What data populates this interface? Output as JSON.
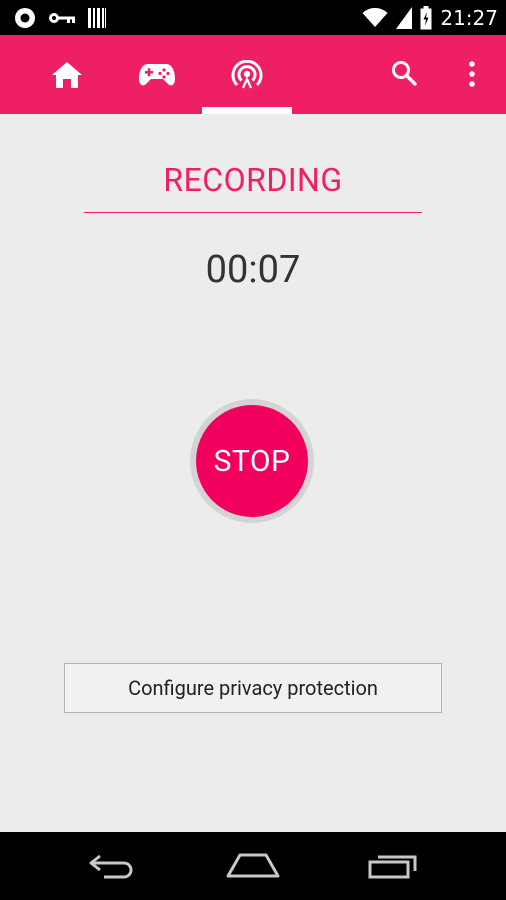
{
  "status_bar": {
    "time": "21:27",
    "icons": [
      "record-indicator-icon",
      "key-icon",
      "barcode-icon",
      "wifi-icon",
      "signal-icon",
      "battery-icon"
    ]
  },
  "app_bar": {
    "tabs": [
      {
        "name": "home",
        "icon": "home-icon"
      },
      {
        "name": "games",
        "icon": "gamepad-icon"
      },
      {
        "name": "live",
        "icon": "broadcast-icon",
        "selected": true
      }
    ],
    "actions": [
      "search-icon",
      "more-vert-icon"
    ],
    "color": "#ef1f63"
  },
  "main": {
    "title": "RECORDING",
    "timer": "00:07",
    "stop_label": "STOP",
    "privacy_button_label": "Configure privacy protection",
    "accent_color": "#f2005e"
  },
  "nav_bar": {
    "buttons": [
      "back-icon",
      "home-icon",
      "recents-icon"
    ]
  }
}
